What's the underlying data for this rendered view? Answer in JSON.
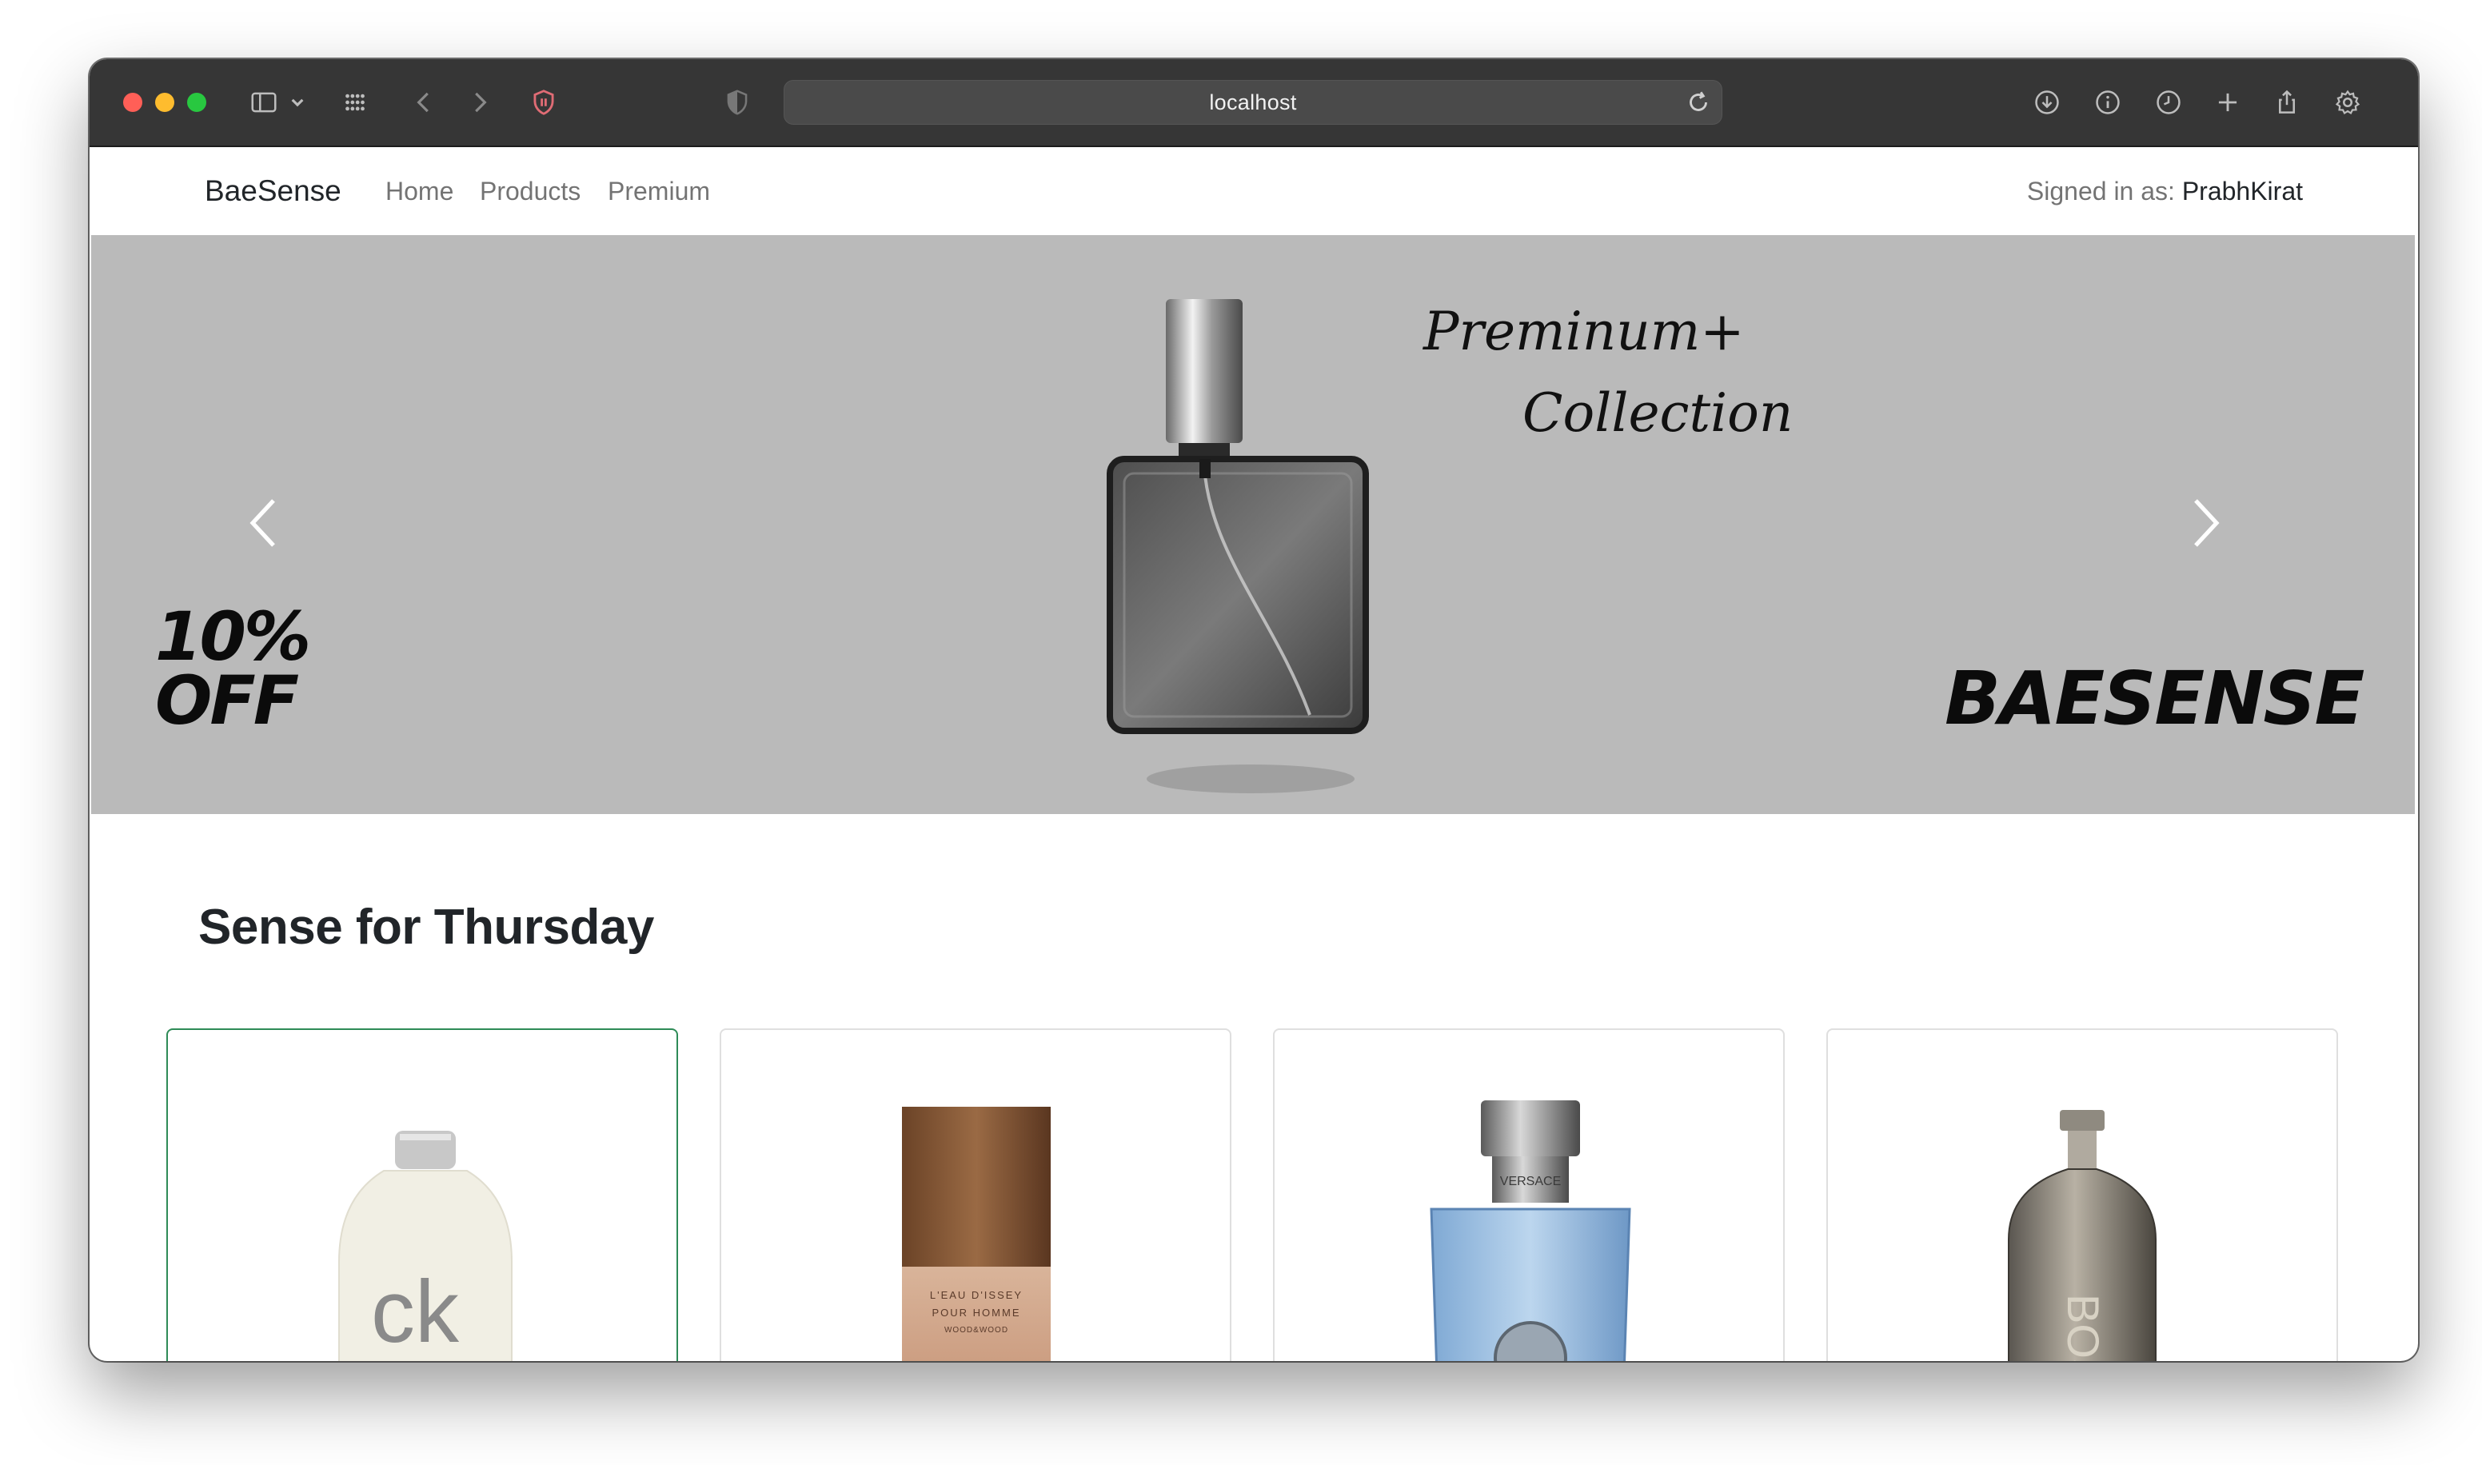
{
  "browser": {
    "url": "localhost",
    "icons": [
      "sidebar-icon",
      "chevron-down-icon",
      "grid-icon",
      "back-icon",
      "forward-icon",
      "shield-icon",
      "privacy-icon",
      "reload-icon",
      "download-icon",
      "info-icon",
      "history-icon",
      "new-tab-icon",
      "share-icon",
      "settings-icon"
    ]
  },
  "navbar": {
    "brand": "BaeSense",
    "links": [
      "Home",
      "Products",
      "Premium"
    ],
    "signed_in_label": "Signed in as: ",
    "user": "PrabhKirat"
  },
  "hero": {
    "discount_line1": "10%",
    "discount_line2": "OFF",
    "script_line1": "Preminum+",
    "script_line2": "Collection",
    "brand_text": "BAESENSE",
    "slide_count": 3,
    "active_slide": 3,
    "background_color": "#bababa"
  },
  "section": {
    "title": "Sense for Thursday"
  },
  "products": [
    {
      "label_text": "ck",
      "active": true
    },
    {
      "label_text": "L'EAU D'ISSEY POUR HOMME WOOD&WOOD",
      "active": false
    },
    {
      "label_text": "VERSACE",
      "active": false
    },
    {
      "label_text": "BOSS",
      "active": false
    }
  ],
  "colors": {
    "accent_active_card": "#2e8b57",
    "titlebar": "#363636"
  }
}
